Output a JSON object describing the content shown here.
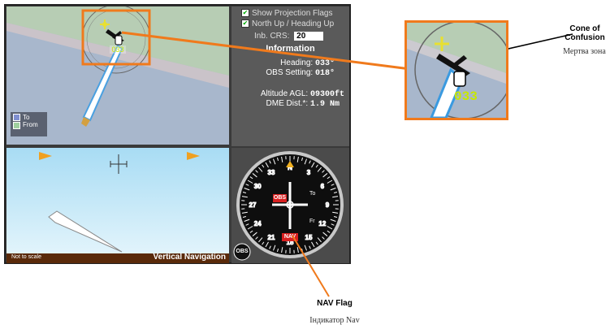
{
  "map": {
    "legend": {
      "to": "To",
      "from": "From"
    },
    "heading_tag": "033"
  },
  "info": {
    "show_projection_flags": "Show Projection Flags",
    "north_up": "North Up / Heading Up",
    "inb_crs_label": "Inb. CRS:",
    "inb_crs_value": "20",
    "title": "Information",
    "heading_label": "Heading:",
    "heading_value": "033°",
    "obs_label": "OBS Setting:",
    "obs_value": "018°",
    "altitude_label": "Altitude AGL:",
    "altitude_value": "09300ft",
    "dme_label": "DME Dist.*:",
    "dme_value": "1.9 Nm"
  },
  "vnav": {
    "not_to_scale": "Not to scale",
    "title": "Vertical Navigation"
  },
  "hsi": {
    "obs_flag": "OBS",
    "nav_flag": "NAV",
    "to_label": "To",
    "fr_label": "Fr",
    "obs_button": "OBS",
    "ticks": [
      "3",
      "6",
      "9",
      "12",
      "15",
      "18",
      "21",
      "24",
      "27",
      "30",
      "33",
      "N"
    ]
  },
  "callouts": {
    "cone_title": "Cone of Confusion",
    "cone_translation": "Мертва зона",
    "zoom_heading_tag": "033",
    "nav_flag_title": "NAV Flag",
    "nav_flag_translation": "Індикатор Nav"
  },
  "colors": {
    "accent": "#f07a1c",
    "sky": "#bfe6f7",
    "map_terrain": "#b7cdb4",
    "map_water": "#a8b7cc"
  }
}
